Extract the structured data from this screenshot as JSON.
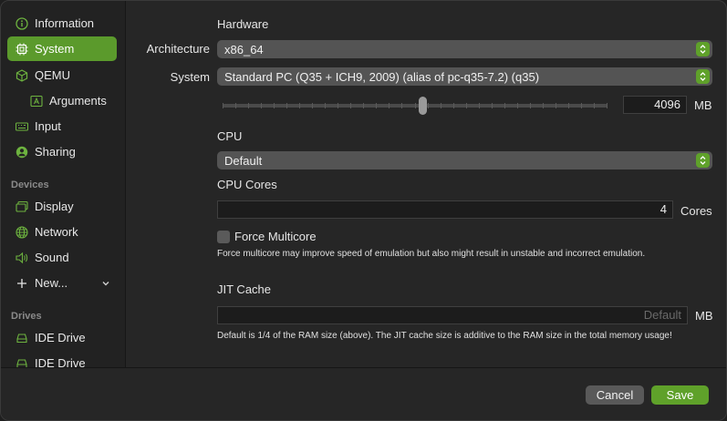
{
  "sidebar": {
    "items": [
      {
        "label": "Information",
        "icon": "info-icon"
      },
      {
        "label": "System",
        "icon": "cpu-icon",
        "active": true
      },
      {
        "label": "QEMU",
        "icon": "cube-icon"
      },
      {
        "label": "Arguments",
        "icon": "text-box-icon"
      },
      {
        "label": "Input",
        "icon": "keyboard-icon"
      },
      {
        "label": "Sharing",
        "icon": "person-icon"
      }
    ],
    "devices_heading": "Devices",
    "devices": [
      {
        "label": "Display",
        "icon": "display-icon"
      },
      {
        "label": "Network",
        "icon": "globe-icon"
      },
      {
        "label": "Sound",
        "icon": "speaker-icon"
      },
      {
        "label": "New...",
        "icon": "plus-icon"
      }
    ],
    "drives_heading": "Drives",
    "drives": [
      {
        "label": "IDE Drive",
        "icon": "drive-icon"
      },
      {
        "label": "IDE Drive",
        "icon": "drive-icon"
      }
    ]
  },
  "hardware": {
    "heading": "Hardware",
    "architecture_label": "Architecture",
    "architecture_value": "x86_64",
    "system_label": "System",
    "system_value": "Standard PC (Q35 + ICH9, 2009) (alias of pc-q35-7.2) (q35)",
    "memory_value": "4096",
    "memory_unit": "MB",
    "memory_fraction": 0.52
  },
  "cpu": {
    "heading": "CPU",
    "value": "Default",
    "cores_heading": "CPU Cores",
    "cores_value": "4",
    "cores_unit": "Cores",
    "force_multicore_label": "Force Multicore",
    "force_multicore_checked": false,
    "force_multicore_note": "Force multicore may improve speed of emulation but also might result in unstable and incorrect emulation."
  },
  "jit": {
    "heading": "JIT Cache",
    "placeholder": "Default",
    "unit": "MB",
    "note": "Default is 1/4 of the RAM size (above). The JIT cache size is additive to the RAM size in the total memory usage!"
  },
  "footer": {
    "cancel_label": "Cancel",
    "save_label": "Save"
  },
  "colors": {
    "accent": "#5fa12a",
    "sidebar_active": "#5b9a2c"
  }
}
